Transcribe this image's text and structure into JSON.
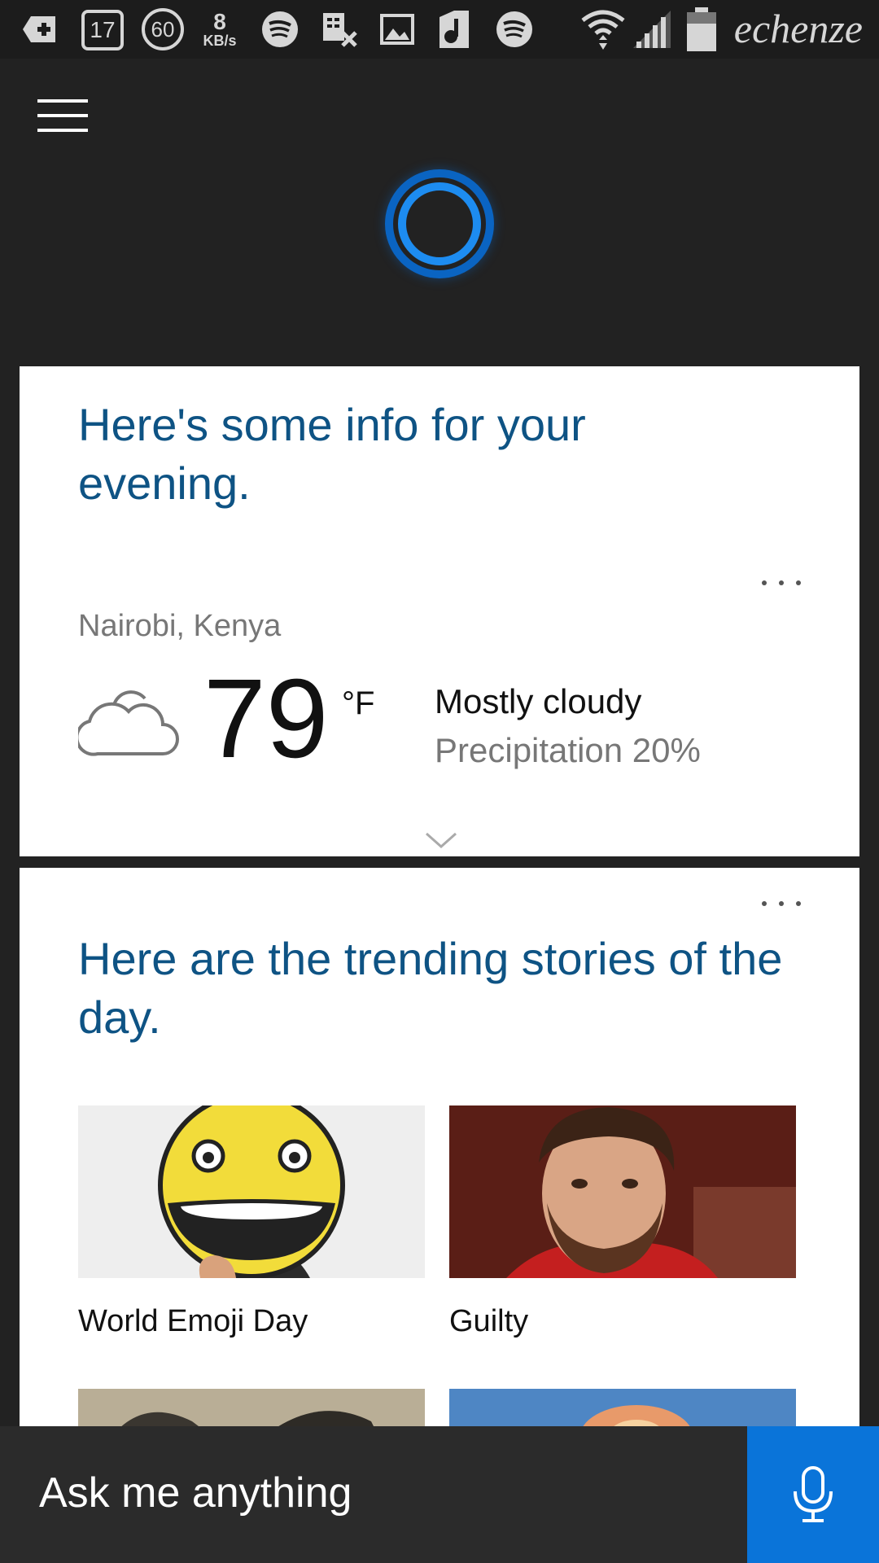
{
  "status_bar": {
    "notif_count": "17",
    "speed_badge": "60",
    "net_speed_value": "8",
    "net_speed_unit": "KB/s",
    "carrier": "echenze",
    "icons": [
      "add-icon",
      "sms-icon",
      "speed-badge-icon",
      "net-speed-icon",
      "spotify-icon",
      "calendar-x-icon",
      "image-icon",
      "music-icon",
      "spotify-icon",
      "wifi-icon",
      "signal-icon",
      "battery-icon"
    ]
  },
  "header": {
    "menu_icon": "hamburger-icon",
    "logo": "cortana-circle-icon",
    "accent_color": "#0a74d9"
  },
  "weather_card": {
    "heading": "Here's some info for your evening.",
    "location": "Nairobi, Kenya",
    "icon": "cloud-icon",
    "temperature": "79",
    "unit": "°F",
    "condition": "Mostly cloudy",
    "precipitation": "Precipitation 20%",
    "more_icon": "more-icon",
    "expand_icon": "chevron-down-icon"
  },
  "trending_card": {
    "heading": "Here are the trending stories of the day.",
    "more_icon": "more-icon",
    "stories": [
      {
        "label": "World Emoji Day",
        "image": "emoji-face-image"
      },
      {
        "label": "Guilty",
        "image": "man-portrait-image"
      },
      {
        "label": "",
        "image": "rocks-image"
      },
      {
        "label": "",
        "image": "fire-sky-image"
      }
    ]
  },
  "search": {
    "placeholder": "Ask me anything",
    "mic_icon": "microphone-icon"
  },
  "heading_color": "#0e5384"
}
